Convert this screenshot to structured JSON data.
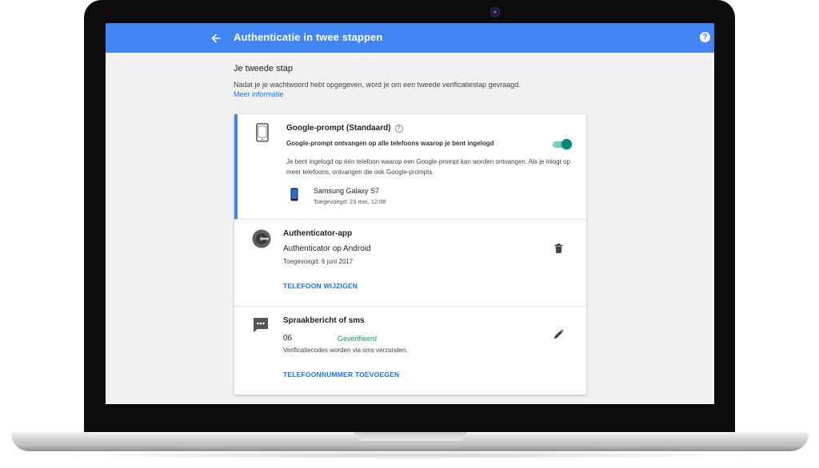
{
  "header": {
    "title": "Authenticatie in twee stappen",
    "help_label": "?"
  },
  "intro": {
    "heading": "Je tweede stap",
    "text": "Nadat je je wachtwoord hebt opgegeven, word je om een tweede verificatiestap gevraagd.",
    "link": "Meer informatie"
  },
  "prompt": {
    "title": "Google-prompt (Standaard)",
    "help_label": "?",
    "subtitle": "Google-prompt ontvangen op alle telefoons waarop je bent ingelogd",
    "description": "Je bent ingelogd op één telefoon waarop een Google-prompt kan worden ontvangen. Als je inlogt op meer telefoons, ontvangen die ook Google-prompts.",
    "toggle_on": true,
    "device": {
      "name": "Samsung Galaxy S7",
      "added": "Toegevoegd: 23 mei, 12:08"
    }
  },
  "authenticator": {
    "title": "Authenticator-app",
    "value": "Authenticator op Android",
    "added": "Toegevoegd: 6 juni 2017",
    "action": "TELEFOON WIJZIGEN"
  },
  "sms": {
    "title": "Spraakbericht of sms",
    "number": "06",
    "status": "Geverifieerd",
    "description": "Verificatiecodes worden via sms verzonden.",
    "action": "TELEFOONNUMMER TOEVOEGEN"
  },
  "colors": {
    "accent": "#4285f4",
    "toggle": "#00897b",
    "verified": "#0f9d58",
    "link": "#1a73e8"
  }
}
